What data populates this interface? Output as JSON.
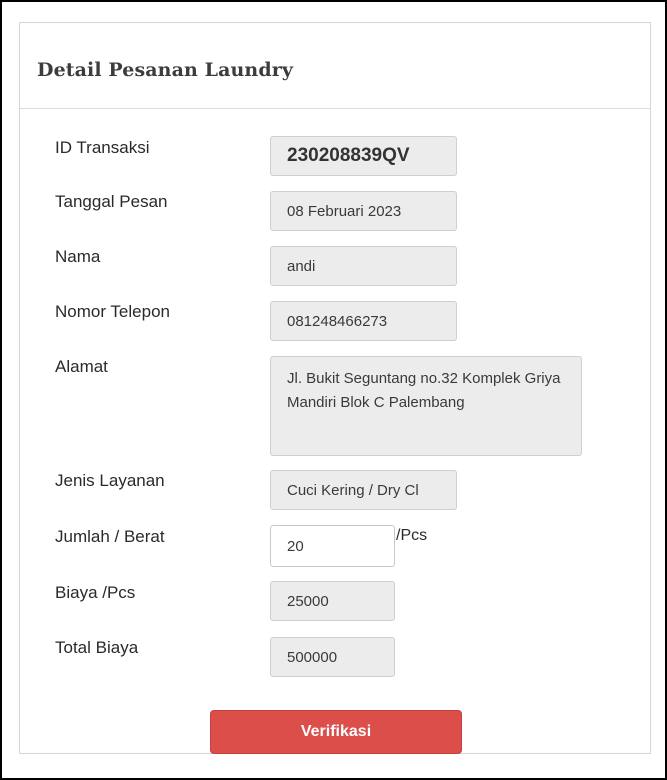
{
  "panel": {
    "title": "Detail Pesanan Laundry"
  },
  "form": {
    "id_transaksi": {
      "label": "ID Transaksi",
      "value": "230208839QV"
    },
    "tanggal_pesan": {
      "label": "Tanggal Pesan",
      "value": "08 Februari 2023"
    },
    "nama": {
      "label": "Nama",
      "value": "andi"
    },
    "nomor_telepon": {
      "label": "Nomor Telepon",
      "value": "081248466273"
    },
    "alamat": {
      "label": "Alamat",
      "value": "Jl. Bukit Seguntang no.32 Komplek Griya Mandiri Blok C Palembang"
    },
    "jenis_layanan": {
      "label": "Jenis Layanan",
      "value": "Cuci Kering / Dry Cl"
    },
    "jumlah_berat": {
      "label": "Jumlah / Berat",
      "value": "20",
      "unit": "/Pcs"
    },
    "biaya_pcs": {
      "label": "Biaya /Pcs",
      "value": "25000"
    },
    "total_biaya": {
      "label": "Total Biaya",
      "value": "500000"
    }
  },
  "actions": {
    "verify_label": "Verifikasi"
  },
  "colors": {
    "primary_button": "#dc4e4a",
    "readonly_field": "#ececec",
    "border": "#d6d6d6"
  }
}
